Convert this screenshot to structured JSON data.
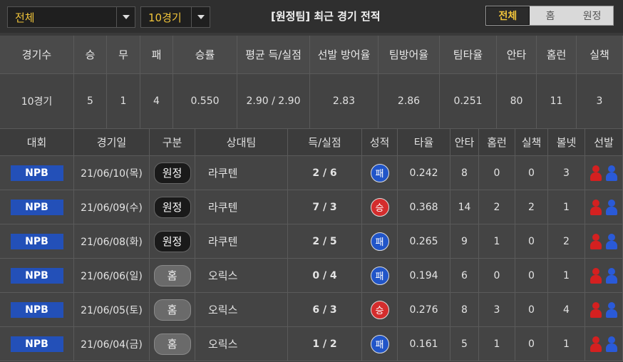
{
  "filters": {
    "team_select": "전체",
    "games_select": "10경기"
  },
  "title": "[원정팀] 최근 경기 전적",
  "segments": [
    "전체",
    "홈",
    "원정"
  ],
  "summary": {
    "headers": [
      "경기수",
      "승",
      "무",
      "패",
      "승률",
      "평균 득/실점",
      "선발 방어율",
      "팀방어율",
      "팀타율",
      "안타",
      "홈런",
      "실책"
    ],
    "values": [
      "10경기",
      "5",
      "1",
      "4",
      "0.550",
      "2.90 / 2.90",
      "2.83",
      "2.86",
      "0.251",
      "80",
      "11",
      "3"
    ]
  },
  "games": {
    "headers": [
      "대회",
      "경기일",
      "구분",
      "상대팀",
      "득/실점",
      "성적",
      "타율",
      "안타",
      "홈런",
      "실책",
      "볼넷",
      "선발"
    ],
    "rows": [
      {
        "league": "NPB",
        "date": "21/06/10(목)",
        "type": "원정",
        "opponent": "라쿠텐",
        "score": "2 / 6",
        "result": "패",
        "avg": "0.242",
        "hits": "8",
        "hr": "0",
        "err": "0",
        "bb": "3"
      },
      {
        "league": "NPB",
        "date": "21/06/09(수)",
        "type": "원정",
        "opponent": "라쿠텐",
        "score": "7 / 3",
        "result": "승",
        "avg": "0.368",
        "hits": "14",
        "hr": "2",
        "err": "2",
        "bb": "1"
      },
      {
        "league": "NPB",
        "date": "21/06/08(화)",
        "type": "원정",
        "opponent": "라쿠텐",
        "score": "2 / 5",
        "result": "패",
        "avg": "0.265",
        "hits": "9",
        "hr": "1",
        "err": "0",
        "bb": "2"
      },
      {
        "league": "NPB",
        "date": "21/06/06(일)",
        "type": "홈",
        "opponent": "오릭스",
        "score": "0 / 4",
        "result": "패",
        "avg": "0.194",
        "hits": "6",
        "hr": "0",
        "err": "0",
        "bb": "1"
      },
      {
        "league": "NPB",
        "date": "21/06/05(토)",
        "type": "홈",
        "opponent": "오릭스",
        "score": "6 / 3",
        "result": "승",
        "avg": "0.276",
        "hits": "8",
        "hr": "3",
        "err": "0",
        "bb": "4"
      },
      {
        "league": "NPB",
        "date": "21/06/04(금)",
        "type": "홈",
        "opponent": "오릭스",
        "score": "1 / 2",
        "result": "패",
        "avg": "0.161",
        "hits": "5",
        "hr": "1",
        "err": "0",
        "bb": "1"
      }
    ]
  },
  "colors": {
    "accent": "#f0c43a",
    "league_badge": "#2350b8",
    "win": "#d42d2d",
    "loss": "#2155c8"
  },
  "icons": {
    "starter_home": "person-red-icon",
    "starter_away": "person-blue-icon"
  }
}
